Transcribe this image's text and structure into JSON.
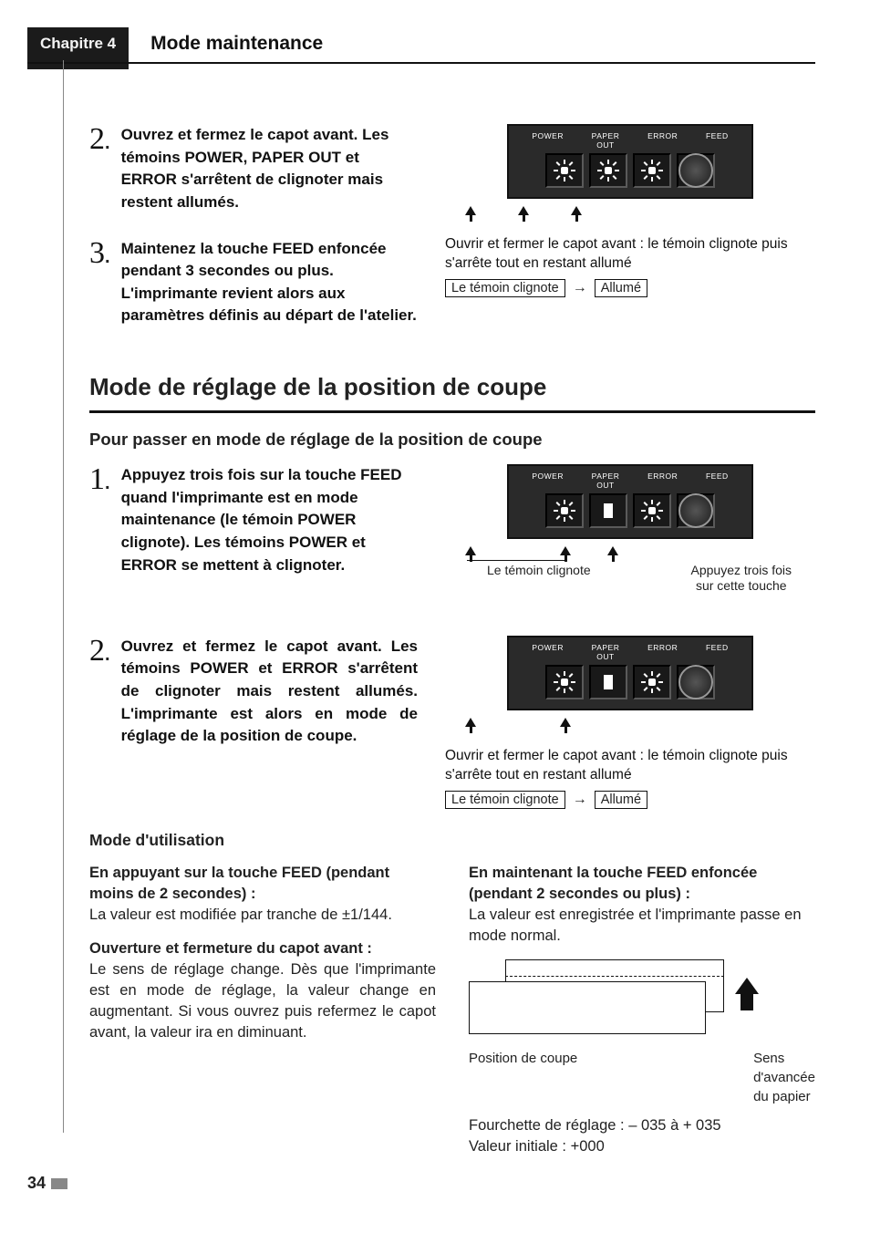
{
  "header": {
    "chapter": "Chapitre 4",
    "title": "Mode maintenance"
  },
  "panel_labels": {
    "power": "POWER",
    "paper_out_1": "PAPER",
    "paper_out_2": "OUT",
    "error": "ERROR",
    "feed": "FEED"
  },
  "top_steps": {
    "s2_num": "2",
    "s2_text": "Ouvrez et fermez le capot avant. Les témoins POWER, PAPER OUT et ERROR s'arrêtent de clignoter mais restent allumés.",
    "s3_num": "3",
    "s3_text": "Maintenez la touche FEED enfoncée pendant 3 secondes ou plus. L'imprimante revient alors aux paramètres définis au départ de l'atelier."
  },
  "top_caption": {
    "line": "Ouvrir et fermer le capot avant : le témoin clignote puis s'arrête tout en restant allumé",
    "state_from": "Le témoin clignote",
    "state_to": "Allumé"
  },
  "section": {
    "title": "Mode de réglage de la position de coupe",
    "subhead": "Pour passer en mode de réglage de la position de coupe"
  },
  "coupe_steps": {
    "s1_num": "1",
    "s1_text": "Appuyez trois fois sur la touche FEED quand l'imprimante est en mode maintenance (le témoin POWER clignote). Les témoins POWER et ERROR se mettent à clignoter.",
    "s2_num": "2",
    "s2_text": "Ouvrez et fermez le capot avant. Les témoins POWER et ERROR s'arrêtent de clignoter mais restent allumés. L'imprimante est alors en mode de réglage de la position de coupe."
  },
  "panel1_under": {
    "left": "Le témoin clignote",
    "right1": "Appuyez trois fois",
    "right2": "sur cette touche"
  },
  "panel2_caption": {
    "line": "Ouvrir et fermer le capot avant : le témoin clignote puis s'arrête tout en restant allumé",
    "state_from": "Le témoin clignote",
    "state_to": "Allumé"
  },
  "mode_util": {
    "heading": "Mode d'utilisation",
    "left_h1": "En appuyant sur la touche FEED (pendant moins de 2 secondes) :",
    "left_p1": "La valeur est modifiée par tranche de ±1/144.",
    "left_h2": "Ouverture et fermeture du capot avant :",
    "left_p2": "Le sens de réglage change. Dès que l'imprimante est en mode de réglage, la valeur change en augmentant. Si vous ouvrez puis refermez le capot avant, la valeur ira en diminuant.",
    "right_h1": "En maintenant la touche FEED enfoncée (pendant 2 secondes ou plus) :",
    "right_p1": "La valeur est enregistrée et l'imprimante passe en mode normal.",
    "cut_label_left": "Position de coupe",
    "cut_label_right1": "Sens",
    "cut_label_right2": "d'avancée",
    "cut_label_right3": "du papier",
    "range": "Fourchette de réglage : – 035 à + 035",
    "initial": "Valeur initiale : +000"
  },
  "page_number": "34"
}
